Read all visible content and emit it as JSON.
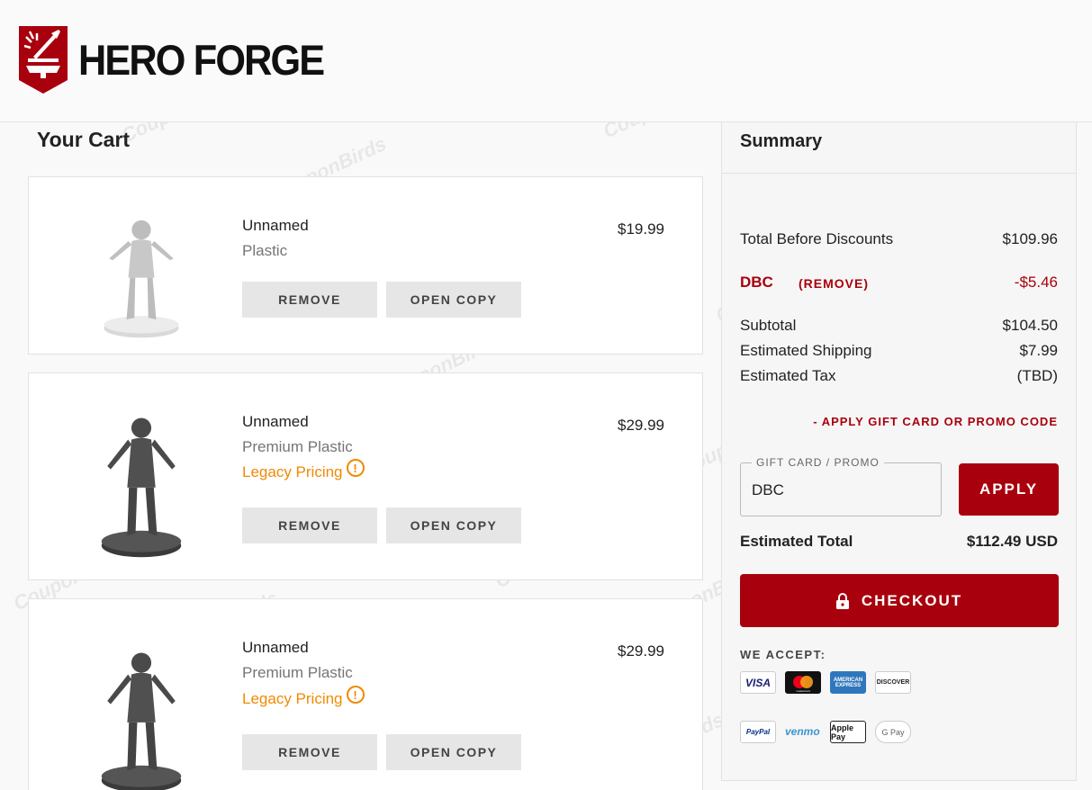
{
  "header": {
    "logo_text": "HERO FORGE",
    "brand_color": "#a8000c"
  },
  "cart": {
    "title": "Your Cart",
    "items": [
      {
        "name": "Unnamed",
        "material": "Plastic",
        "legacy": "",
        "price": "$19.99",
        "remove_label": "REMOVE",
        "copy_label": "OPEN COPY"
      },
      {
        "name": "Unnamed",
        "material": "Premium Plastic",
        "legacy": "Legacy Pricing",
        "price": "$29.99",
        "remove_label": "REMOVE",
        "copy_label": "OPEN COPY"
      },
      {
        "name": "Unnamed",
        "material": "Premium Plastic",
        "legacy": "Legacy Pricing",
        "price": "$29.99",
        "remove_label": "REMOVE",
        "copy_label": "OPEN COPY"
      }
    ]
  },
  "summary": {
    "title": "Summary",
    "total_before_label": "Total Before Discounts",
    "total_before_value": "$109.96",
    "discount_code": "DBC",
    "discount_remove": "(REMOVE)",
    "discount_value": "-$5.46",
    "subtotal_label": "Subtotal",
    "subtotal_value": "$104.50",
    "shipping_label": "Estimated Shipping",
    "shipping_value": "$7.99",
    "tax_label": "Estimated Tax",
    "tax_value": "(TBD)",
    "apply_link": "- APPLY GIFT CARD OR PROMO CODE",
    "promo_legend": "GIFT CARD / PROMO",
    "promo_value": "DBC",
    "apply_button": "APPLY",
    "estimated_total_label": "Estimated Total",
    "estimated_total_value": "$112.49 USD",
    "checkout_button": "CHECKOUT",
    "we_accept": "WE ACCEPT:",
    "payment_methods": [
      "VISA",
      "mastercard",
      "AMERICAN EXPRESS",
      "DISCOVER",
      "PayPal",
      "venmo",
      "Apple Pay",
      "G Pay"
    ]
  },
  "watermark_text": "CouponBirds"
}
